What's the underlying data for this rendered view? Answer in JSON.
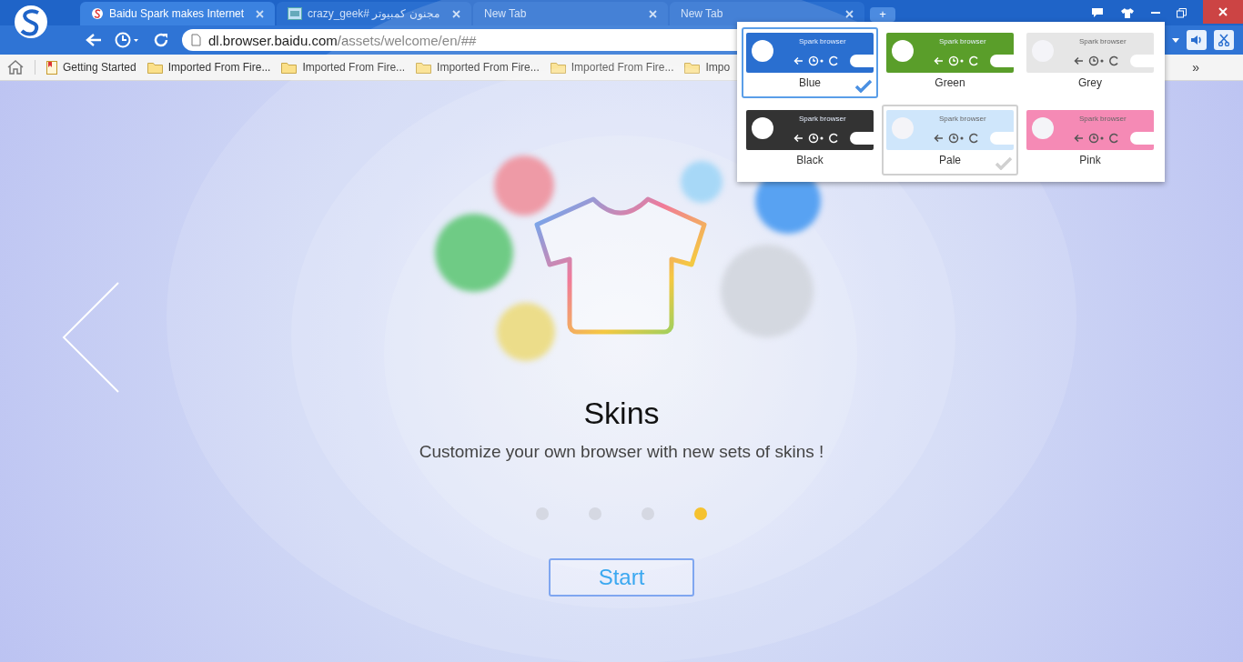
{
  "tabs": [
    {
      "title": "Baidu Spark makes Internet",
      "selected": true,
      "kind": "spark"
    },
    {
      "title": "crazy_geek# مجنون كمبيوتر",
      "selected": false,
      "kind": "image"
    },
    {
      "title": "New Tab",
      "selected": false,
      "kind": "blank"
    },
    {
      "title": "New Tab",
      "selected": false,
      "kind": "blank"
    }
  ],
  "new_tab_button": "+",
  "address": {
    "domain": "dl.browser.baidu.com",
    "path": "/assets/welcome/en/##"
  },
  "bookmarks": [
    {
      "label": "Getting Started",
      "kind": "page"
    },
    {
      "label": "Imported From Fire...",
      "kind": "folder"
    },
    {
      "label": "Imported From Fire...",
      "kind": "folder"
    },
    {
      "label": "Imported From Fire...",
      "kind": "folder"
    },
    {
      "label": "Imported From Fire...",
      "kind": "folder"
    },
    {
      "label": "Impo",
      "kind": "folder"
    }
  ],
  "bookmarks_more": "»",
  "skins_menu": {
    "skins": [
      {
        "name": "Blue",
        "preview_title": "Spark browser",
        "color": "#2a6fd0",
        "selected": true,
        "hovered": false
      },
      {
        "name": "Green",
        "preview_title": "Spark browser",
        "color": "#5a9e2a",
        "selected": false,
        "hovered": false
      },
      {
        "name": "Grey",
        "preview_title": "Spark browser",
        "color": "#e6e6e6",
        "selected": false,
        "hovered": false
      },
      {
        "name": "Black",
        "preview_title": "Spark browser",
        "color": "#333333",
        "selected": false,
        "hovered": false
      },
      {
        "name": "Pale",
        "preview_title": "Spark browser",
        "color": "#cfe6fb",
        "selected": false,
        "hovered": true
      },
      {
        "name": "Pink",
        "preview_title": "Spark browser",
        "color": "#f58ab5",
        "selected": false,
        "hovered": false
      }
    ]
  },
  "slide": {
    "title": "Skins",
    "subtitle": "Customize your own browser with new sets of skins !",
    "dots": [
      {
        "selected": false
      },
      {
        "selected": false
      },
      {
        "selected": false
      },
      {
        "selected": true
      }
    ],
    "button": "Start"
  }
}
